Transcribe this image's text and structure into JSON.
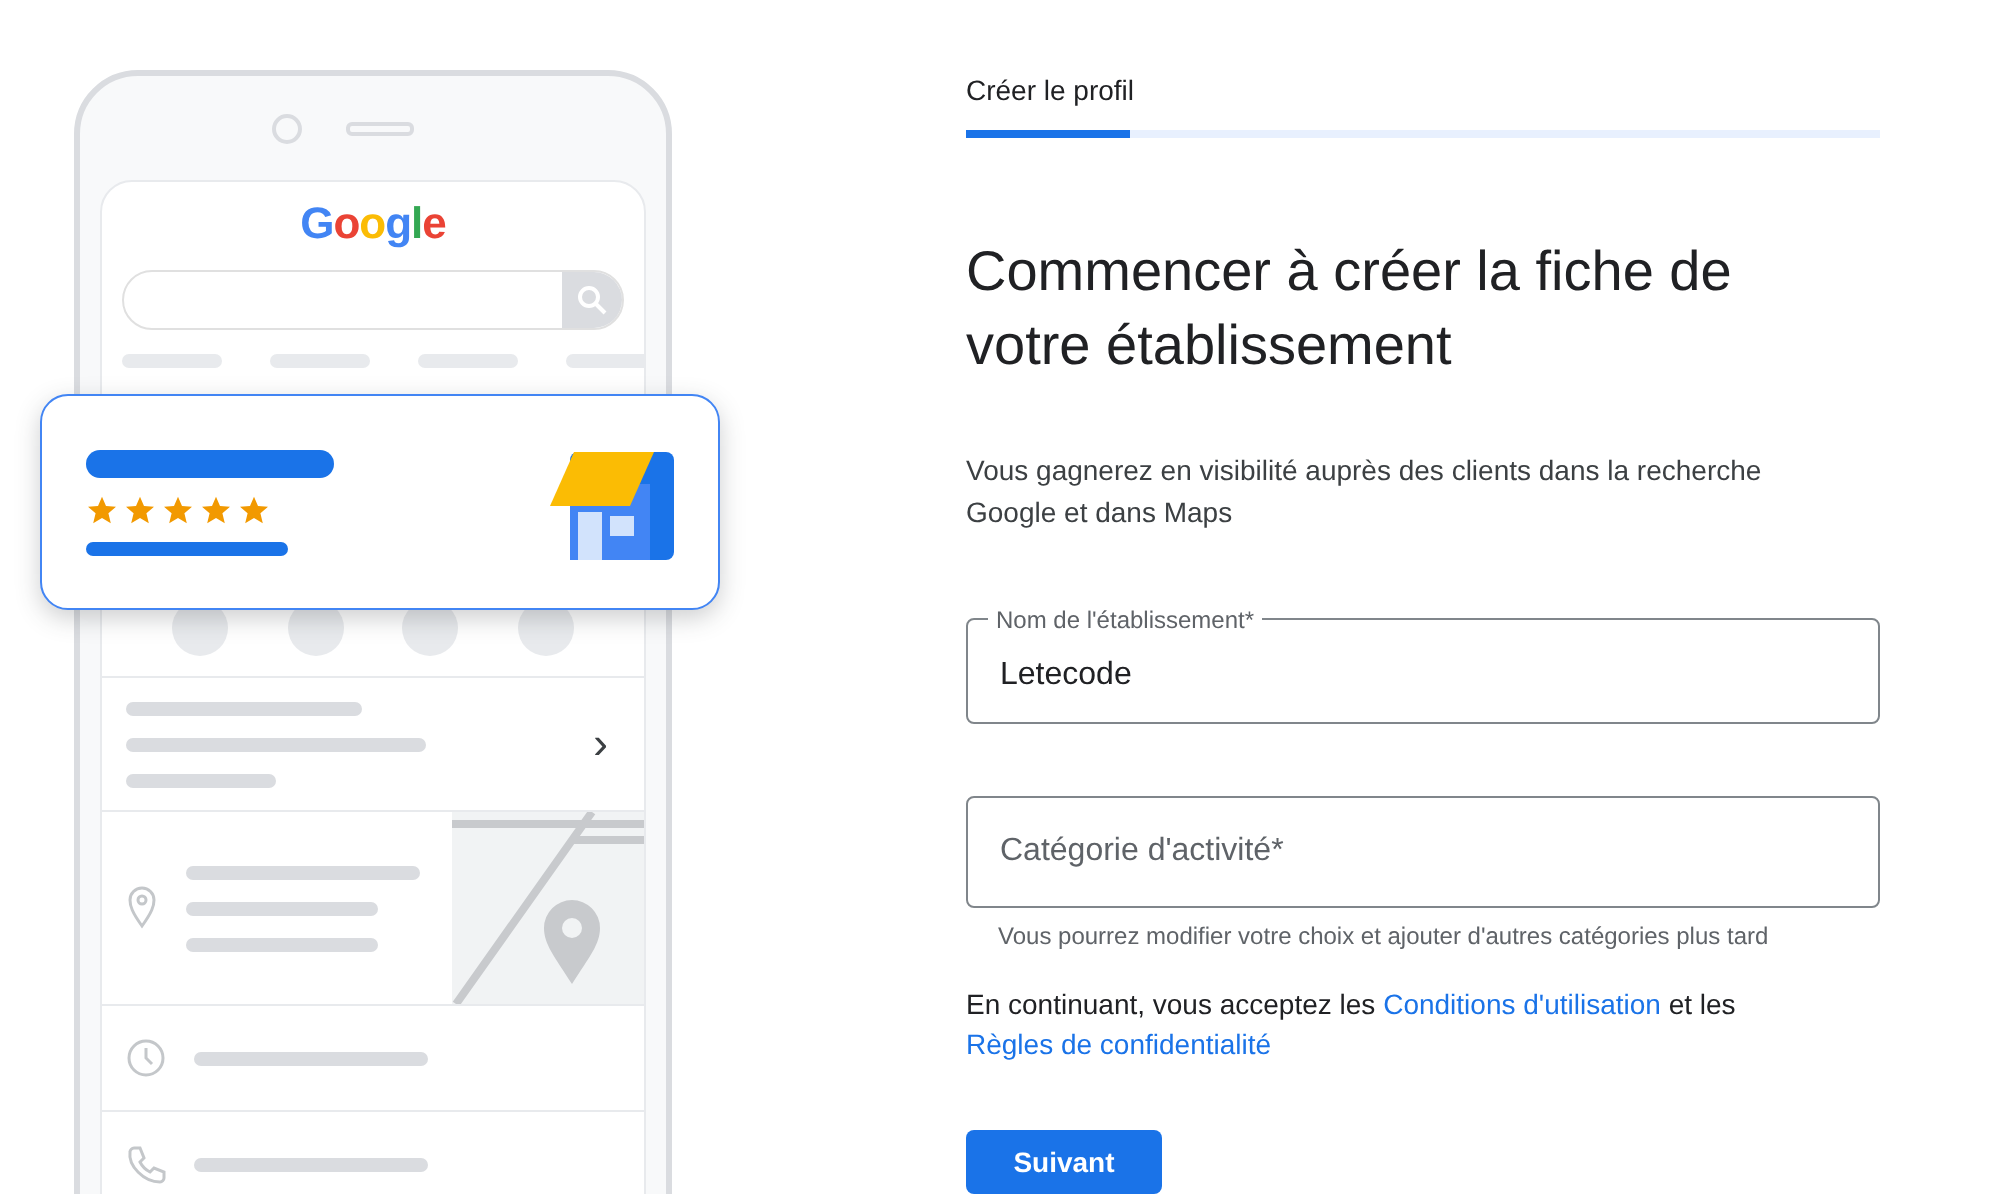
{
  "illustration": {
    "logo": "Google",
    "listing_card": {
      "stars": 5
    },
    "chevron": "›"
  },
  "steps": {
    "title": "Créer le profil",
    "level": 0.18
  },
  "heading": "Commencer à créer la fiche de votre établissement",
  "description": "Vous gagnerez en visibilité auprès des clients dans la recherche Google et dans Maps",
  "fields": [
    {
      "label": "Nom de l'établissement*",
      "value": "Letecode"
    },
    {
      "placeholder": "Catégorie d'activité*",
      "helper": "Vous pourrez modifier votre choix et ajouter d'autres catégories plus tard"
    }
  ],
  "terms": {
    "before": "En continuant, vous acceptez les",
    "link_1": "Conditions d'utilisation",
    "middle": "et les",
    "link_2": "Règles de confidentialité"
  },
  "button": "Suivant"
}
